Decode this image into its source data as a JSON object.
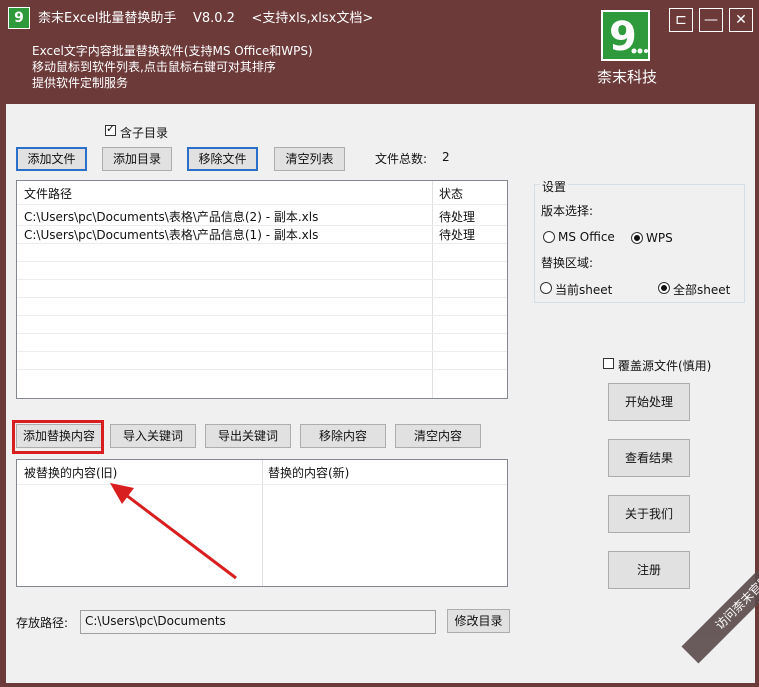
{
  "window": {
    "title": "柰末Excel批量替换助手",
    "version": "V8.0.2",
    "subtitle": "<支持xls,xlsx文档>",
    "app_icon_glyph": "9",
    "desc_lines": [
      "Excel文字内容批量替换软件(支持MS Office和WPS)",
      "移动鼠标到软件列表,点击鼠标右键可对其排序",
      "提供软件定制服务"
    ],
    "brand": "柰末科技",
    "controls": {
      "pin": "⊏",
      "minimize": "—",
      "close": "✕"
    },
    "colors": {
      "titlebar": "#6d3a3a",
      "logo_green": "#2e9a3b",
      "highlight_red": "#d81e1e"
    }
  },
  "files": {
    "include_subdirs_label": "含子目录",
    "include_subdirs_checked": true,
    "buttons": {
      "add_file": "添加文件",
      "add_dir": "添加目录",
      "remove_file": "移除文件",
      "clear_list": "清空列表"
    },
    "total_label": "文件总数:",
    "total_count": "2",
    "columns": {
      "path": "文件路径",
      "status": "状态"
    },
    "rows": [
      {
        "path": "C:\\Users\\pc\\Documents\\表格\\产品信息(2) - 副本.xls",
        "status": "待处理"
      },
      {
        "path": "C:\\Users\\pc\\Documents\\表格\\产品信息(1) - 副本.xls",
        "status": "待处理"
      }
    ]
  },
  "settings": {
    "group_label": "设置",
    "version_label": "版本选择:",
    "version_options": {
      "ms": "MS Office",
      "wps": "WPS"
    },
    "version_selected": "wps",
    "range_label": "替换区域:",
    "range_options": {
      "current": "当前sheet",
      "all": "全部sheet"
    },
    "range_selected": "all",
    "overwrite_label": "覆盖源文件(慎用)",
    "overwrite_checked": false
  },
  "actions": {
    "start": "开始处理",
    "view_results": "查看结果",
    "about": "关于我们",
    "register": "注册"
  },
  "replace": {
    "buttons": {
      "add": "添加替换内容",
      "import": "导入关键词",
      "export": "导出关键词",
      "remove": "移除内容",
      "clear": "清空内容"
    },
    "columns": {
      "old": "被替换的内容(旧)",
      "new": "替换的内容(新)"
    }
  },
  "save": {
    "label": "存放路径:",
    "path": "C:\\Users\\pc\\Documents",
    "change_button": "修改目录"
  },
  "watermark": "访问柰末官网"
}
